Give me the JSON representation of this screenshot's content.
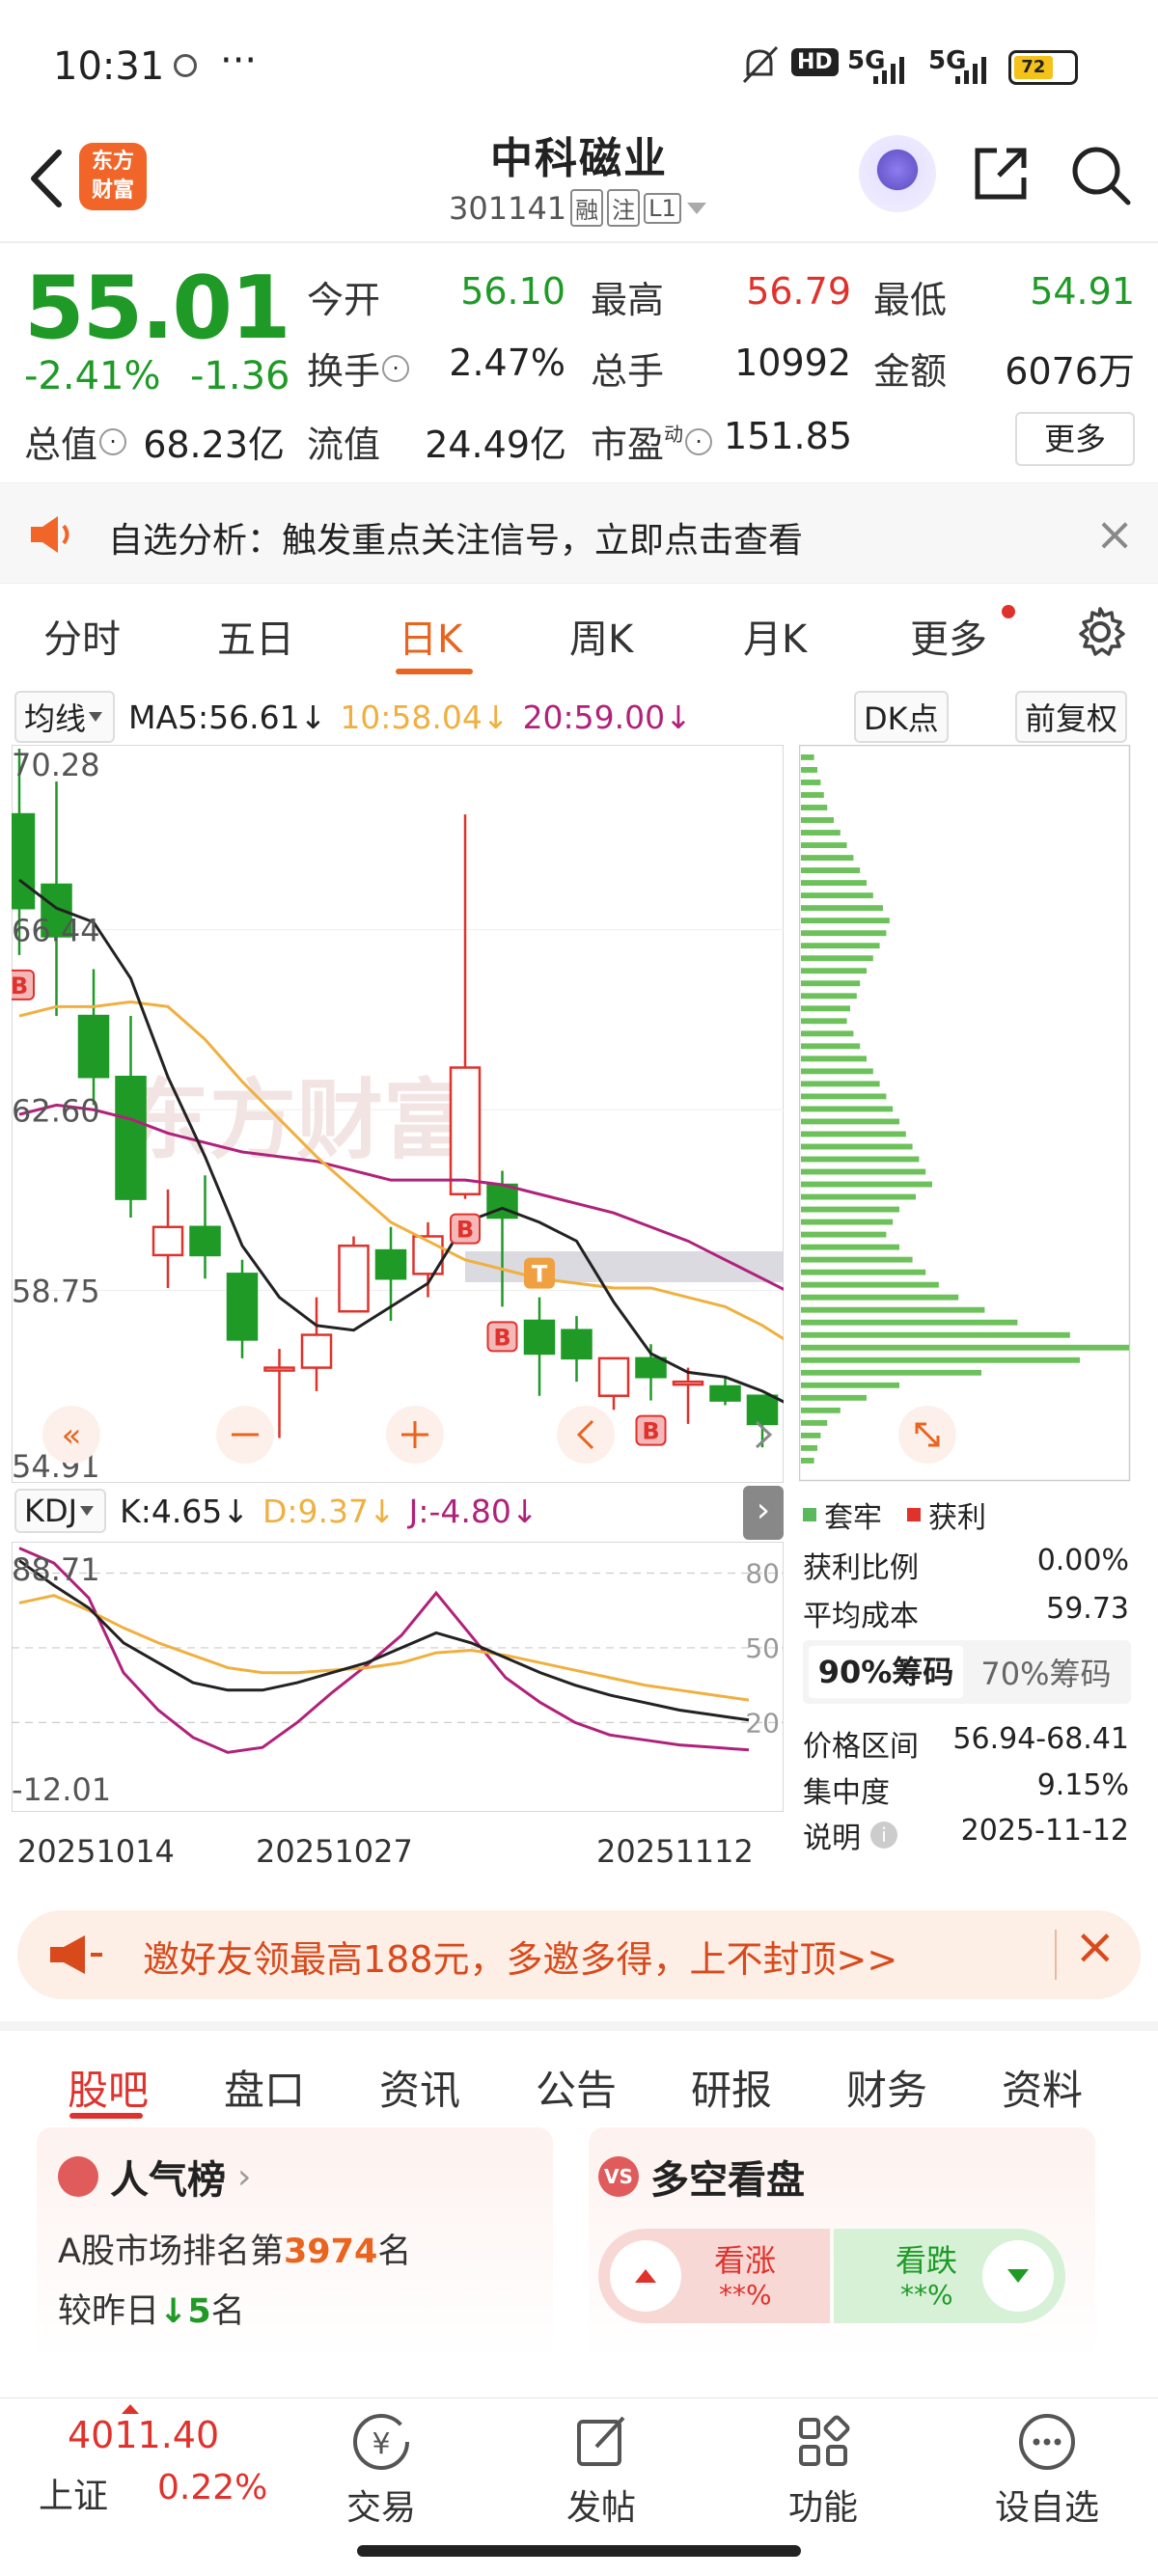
{
  "status": {
    "time": "10:31",
    "battery": "72",
    "net1": "5G",
    "net2": "5G",
    "hd": "HD"
  },
  "header": {
    "stock_name": "中科磁业",
    "stock_code": "301141",
    "tags": [
      "融",
      "注",
      "L1"
    ],
    "logo_line1": "东方",
    "logo_line2": "财富"
  },
  "quote": {
    "price": "55.01",
    "change_pct": "-2.41%",
    "change": "-1.36",
    "open_label": "今开",
    "open": "56.10",
    "high_label": "最高",
    "high": "56.79",
    "low_label": "最低",
    "low": "54.91",
    "turnover_label": "换手",
    "turnover": "2.47%",
    "volume_label": "总手",
    "volume": "10992",
    "amount_label": "金额",
    "amount": "6076万",
    "mktcap_label": "总值",
    "mktcap": "68.23亿",
    "float_label": "流值",
    "float": "24.49亿",
    "pe_label": "市盈",
    "pe_sup": "动",
    "pe": "151.85",
    "more": "更多"
  },
  "notice": {
    "text": "自选分析：触发重点关注信号，立即点击查看"
  },
  "kline_tabs": [
    {
      "label": "分时"
    },
    {
      "label": "五日"
    },
    {
      "label": "日K"
    },
    {
      "label": "周K"
    },
    {
      "label": "月K"
    },
    {
      "label": "更多"
    }
  ],
  "ma_row": {
    "selector": "均线",
    "ma5": "MA5:56.61",
    "ma10": "10:58.04",
    "ma20": "20:59.00",
    "dk": "DK点",
    "adjust": "前复权"
  },
  "colors": {
    "up": "#e0322c",
    "down": "#1f9a27",
    "ma5": "#222222",
    "ma10": "#f0b040",
    "ma20": "#b0227a",
    "accent": "#e8641f"
  },
  "kline_axis": {
    "top": "70.28",
    "l2": "66.44",
    "l3": "62.60",
    "l4": "58.75",
    "bottom": "54.91"
  },
  "chart_data": {
    "type": "candlestick",
    "ylim": [
      54.91,
      70.28
    ],
    "candles": [
      {
        "o": 68.9,
        "c": 66.9,
        "h": 70.3,
        "l": 65.9
      },
      {
        "o": 67.4,
        "c": 66.3,
        "h": 69.6,
        "l": 64.6
      },
      {
        "o": 64.6,
        "c": 63.3,
        "h": 65.6,
        "l": 62.7
      },
      {
        "o": 63.3,
        "c": 60.7,
        "h": 64.6,
        "l": 60.3
      },
      {
        "o": 59.5,
        "c": 60.1,
        "h": 60.9,
        "l": 58.8
      },
      {
        "o": 60.1,
        "c": 59.5,
        "h": 61.2,
        "l": 59.0
      },
      {
        "o": 59.1,
        "c": 57.7,
        "h": 59.4,
        "l": 57.3
      },
      {
        "o": 57.1,
        "c": 57.1,
        "h": 57.5,
        "l": 55.6
      },
      {
        "o": 57.1,
        "c": 57.8,
        "h": 58.6,
        "l": 56.6
      },
      {
        "o": 58.3,
        "c": 59.7,
        "h": 59.9,
        "l": 58.3
      },
      {
        "o": 59.6,
        "c": 59.0,
        "h": 60.1,
        "l": 58.1
      },
      {
        "o": 59.1,
        "c": 59.9,
        "h": 60.2,
        "l": 58.6
      },
      {
        "o": 60.8,
        "c": 63.5,
        "h": 68.9,
        "l": 60.7
      },
      {
        "o": 61.0,
        "c": 60.3,
        "h": 61.3,
        "l": 58.4
      },
      {
        "o": 58.1,
        "c": 57.4,
        "h": 58.6,
        "l": 56.5
      },
      {
        "o": 57.9,
        "c": 57.3,
        "h": 58.2,
        "l": 56.8
      },
      {
        "o": 56.5,
        "c": 57.3,
        "h": 57.3,
        "l": 56.2
      },
      {
        "o": 57.3,
        "c": 56.9,
        "h": 57.6,
        "l": 56.4
      },
      {
        "o": 56.8,
        "c": 56.8,
        "h": 57.1,
        "l": 55.9
      },
      {
        "o": 56.7,
        "c": 56.4,
        "h": 56.9,
        "l": 56.3
      },
      {
        "o": 56.5,
        "c": 55.9,
        "h": 56.5,
        "l": 55.4
      },
      {
        "o": 55.9,
        "c": 54.9,
        "h": 56.0,
        "l": 54.9
      }
    ],
    "ma5": [
      67.5,
      66.9,
      66.6,
      65.4,
      63.3,
      61.6,
      59.7,
      58.6,
      58.0,
      57.9,
      58.4,
      58.9,
      60.2,
      60.5,
      60.2,
      59.8,
      58.5,
      57.4,
      57.0,
      56.9,
      56.6,
      56.2
    ],
    "ma10": [
      64.6,
      64.8,
      64.8,
      64.9,
      64.8,
      64.1,
      63.2,
      62.4,
      61.6,
      60.9,
      60.2,
      59.8,
      59.4,
      59.2,
      59.0,
      58.9,
      58.8,
      58.8,
      58.6,
      58.4,
      58.0,
      57.5
    ],
    "ma20": [
      62.5,
      62.7,
      62.6,
      62.4,
      62.1,
      61.9,
      61.7,
      61.6,
      61.5,
      61.3,
      61.1,
      61.1,
      61.1,
      61.0,
      60.8,
      60.6,
      60.4,
      60.1,
      59.8,
      59.4,
      59.0,
      58.6
    ],
    "markers": [
      {
        "i": 0,
        "label": "B"
      },
      {
        "i": 12,
        "label": "B"
      },
      {
        "i": 13,
        "label": "B"
      },
      {
        "i": 14,
        "label": "T"
      },
      {
        "i": 17,
        "label": "B"
      }
    ],
    "dates": [
      "20251014",
      "20251027",
      "20251112"
    ]
  },
  "kdj": {
    "selector": "KDJ",
    "k": "K:4.65",
    "d": "D:9.37",
    "j": "J:-4.80",
    "axis_top": "88.71",
    "axis_bottom": "-12.01",
    "levels": [
      "80",
      "50",
      "20"
    ],
    "k_series": [
      85,
      75,
      66,
      52,
      44,
      36,
      33,
      33,
      36,
      40,
      44,
      50,
      56,
      52,
      46,
      40,
      35,
      31,
      28,
      25,
      23,
      21
    ],
    "d_series": [
      68,
      71,
      65,
      58,
      52,
      47,
      42,
      40,
      40,
      41,
      42,
      44,
      48,
      49,
      47,
      44,
      41,
      38,
      35,
      33,
      31,
      29
    ],
    "j_series": [
      90,
      84,
      70,
      40,
      25,
      14,
      8,
      10,
      20,
      32,
      43,
      55,
      72,
      55,
      38,
      28,
      20,
      15,
      13,
      11,
      10,
      9
    ]
  },
  "chips": {
    "legend_trapped": "套牢",
    "legend_profit": "获利",
    "profit_ratio_label": "获利比例",
    "profit_ratio": "0.00%",
    "avg_cost_label": "平均成本",
    "avg_cost": "59.73",
    "tab90": "90%筹码",
    "tab70": "70%筹码",
    "range_label": "价格区间",
    "range": "56.94-68.41",
    "concentration_label": "集中度",
    "concentration": "9.15%",
    "note_label": "说明",
    "note_date": "2025-11-12",
    "bars": [
      0.04,
      0.05,
      0.06,
      0.07,
      0.08,
      0.1,
      0.12,
      0.14,
      0.16,
      0.18,
      0.2,
      0.22,
      0.25,
      0.27,
      0.26,
      0.24,
      0.22,
      0.2,
      0.18,
      0.17,
      0.15,
      0.14,
      0.16,
      0.18,
      0.2,
      0.22,
      0.24,
      0.26,
      0.28,
      0.3,
      0.32,
      0.34,
      0.36,
      0.38,
      0.4,
      0.35,
      0.3,
      0.28,
      0.26,
      0.3,
      0.34,
      0.38,
      0.42,
      0.48,
      0.56,
      0.66,
      0.82,
      1.0,
      0.85,
      0.55,
      0.3,
      0.2,
      0.12,
      0.08,
      0.06,
      0.05,
      0.04
    ]
  },
  "invite": {
    "text": "邀好友领最高188元，多邀多得，上不封顶>>"
  },
  "bottom_tabs": [
    {
      "label": "股吧"
    },
    {
      "label": "盘口"
    },
    {
      "label": "资讯"
    },
    {
      "label": "公告"
    },
    {
      "label": "研报"
    },
    {
      "label": "财务"
    },
    {
      "label": "资料"
    }
  ],
  "popularity": {
    "title": "人气榜",
    "rank_prefix": "A股市场排名第",
    "rank": "3974",
    "rank_suffix": "名",
    "delta_prefix": "较昨日",
    "delta": "5",
    "delta_suffix": "名"
  },
  "bullbear": {
    "title": "多空看盘",
    "bull_label": "看涨",
    "bull_pct": "**%",
    "bear_label": "看跌",
    "bear_pct": "**%"
  },
  "nav": {
    "index_value": "4011.40",
    "index_name": "上证",
    "index_change": "0.22%",
    "items": [
      {
        "label": "交易"
      },
      {
        "label": "发帖"
      },
      {
        "label": "功能"
      },
      {
        "label": "设自选"
      }
    ]
  }
}
